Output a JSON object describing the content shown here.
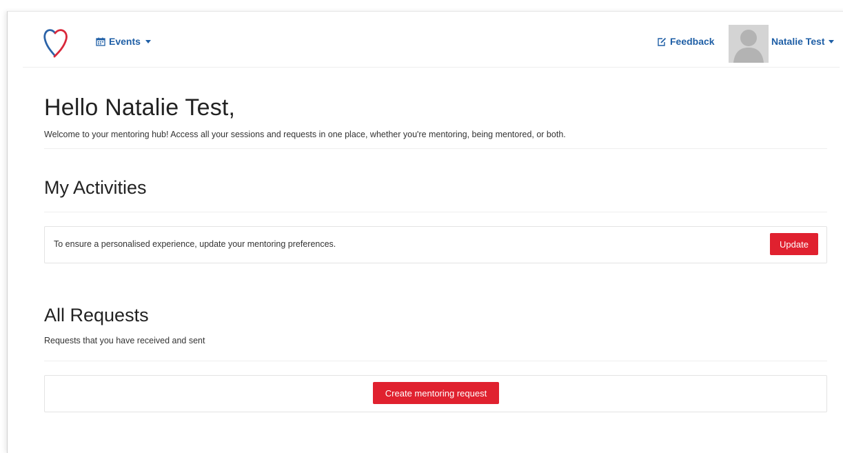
{
  "navbar": {
    "events_label": "Events",
    "feedback_label": "Feedback",
    "user_name": "Natalie Test"
  },
  "main": {
    "greeting": "Hello Natalie Test,",
    "welcome_text": "Welcome to your mentoring hub! Access all your sessions and requests in one place, whether you're mentoring, being mentored, or both.",
    "activities": {
      "title": "My Activities",
      "preferences_text": "To ensure a personalised experience, update your mentoring preferences.",
      "update_label": "Update"
    },
    "requests": {
      "title": "All Requests",
      "subtitle": "Requests that you have received and sent",
      "create_label": "Create mentoring request"
    }
  },
  "colors": {
    "link_blue": "#1f5fa6",
    "accent_red": "#e0212f",
    "logo_blue": "#2b63a8",
    "logo_red": "#d9283a"
  },
  "icons": {
    "logo": "heart-logo",
    "events": "calendar-icon",
    "feedback": "edit-icon",
    "user": "avatar-placeholder",
    "dropdown": "caret-down-icon"
  }
}
